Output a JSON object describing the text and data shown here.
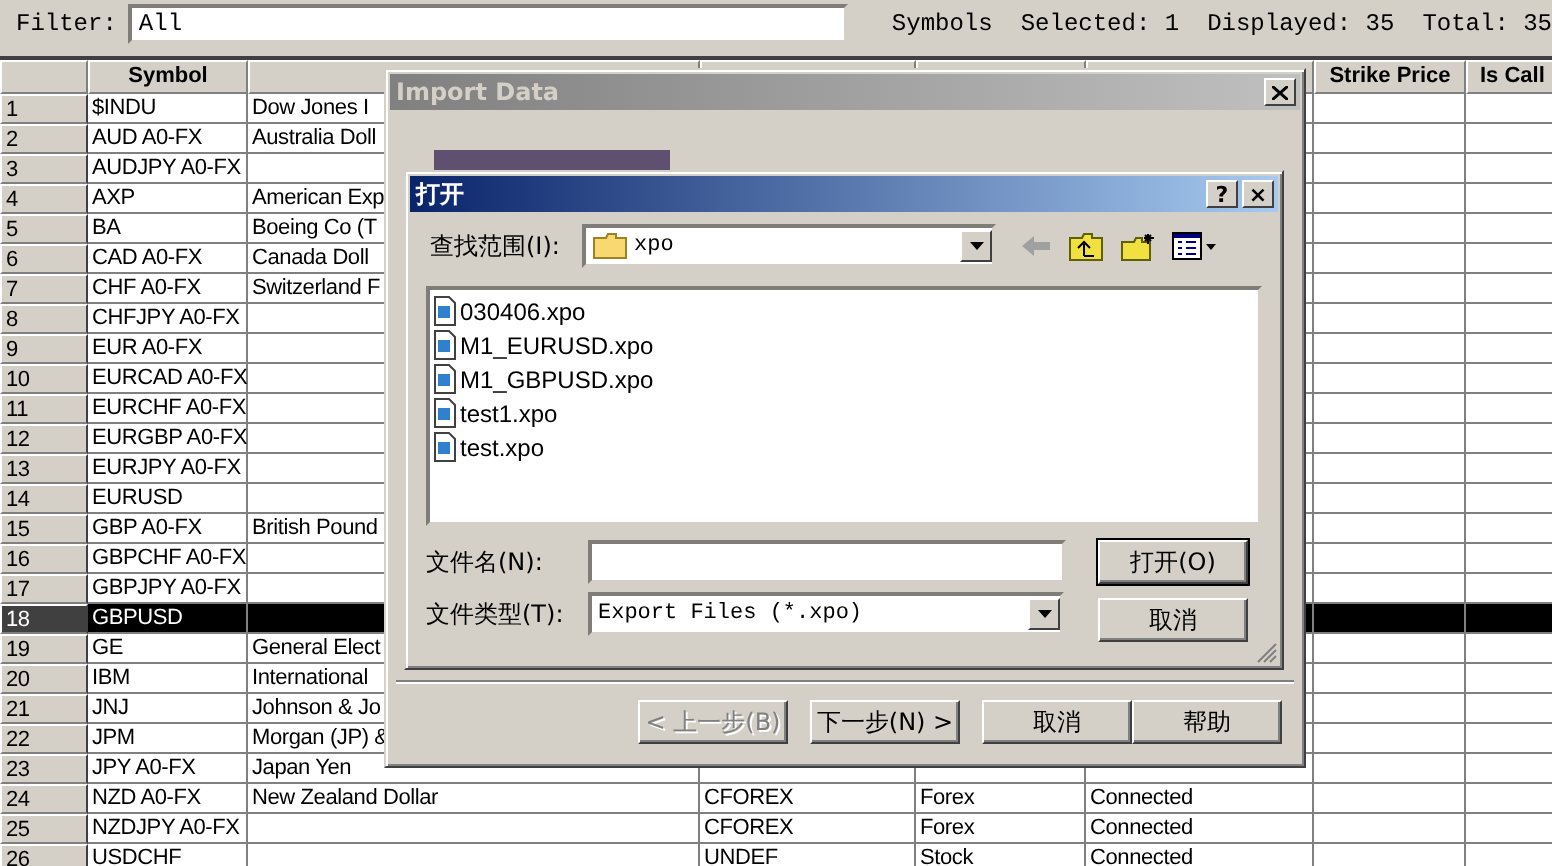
{
  "filter": {
    "label": "Filter:",
    "value": "All"
  },
  "summary": [
    "Symbols",
    "Selected: 1",
    "Displayed: 35",
    "Total: 35"
  ],
  "table": {
    "columns": [
      "Symbol",
      "Strike Price",
      "Is Call"
    ],
    "rows": [
      {
        "number": "1",
        "symbol": "$INDU",
        "description": "Dow Jones I",
        "selected": false
      },
      {
        "number": "2",
        "symbol": "AUD A0-FX",
        "description": "Australia Doll",
        "selected": false
      },
      {
        "number": "3",
        "symbol": "AUDJPY A0-FX",
        "selected": false
      },
      {
        "number": "4",
        "symbol": "AXP",
        "description": "American Exp",
        "selected": false
      },
      {
        "number": "5",
        "symbol": "BA",
        "description": "Boeing Co (T",
        "selected": false
      },
      {
        "number": "6",
        "symbol": "CAD A0-FX",
        "description": "Canada Doll",
        "selected": false
      },
      {
        "number": "7",
        "symbol": "CHF A0-FX",
        "description": "Switzerland F",
        "selected": false
      },
      {
        "number": "8",
        "symbol": "CHFJPY A0-FX",
        "selected": false
      },
      {
        "number": "9",
        "symbol": "EUR A0-FX",
        "selected": false
      },
      {
        "number": "10",
        "symbol": "EURCAD A0-FX",
        "selected": false
      },
      {
        "number": "11",
        "symbol": "EURCHF A0-FX",
        "selected": false
      },
      {
        "number": "12",
        "symbol": "EURGBP A0-FX",
        "selected": false
      },
      {
        "number": "13",
        "symbol": "EURJPY A0-FX",
        "selected": false
      },
      {
        "number": "14",
        "symbol": "EURUSD",
        "selected": false
      },
      {
        "number": "15",
        "symbol": "GBP A0-FX",
        "description": "British Pound",
        "selected": false
      },
      {
        "number": "16",
        "symbol": "GBPCHF A0-FX",
        "selected": false
      },
      {
        "number": "17",
        "symbol": "GBPJPY A0-FX",
        "selected": false
      },
      {
        "number": "18",
        "symbol": "GBPUSD",
        "selected": true
      },
      {
        "number": "19",
        "symbol": "GE",
        "description": "General Elect",
        "selected": false
      },
      {
        "number": "20",
        "symbol": "IBM",
        "description": "International",
        "selected": false
      },
      {
        "number": "21",
        "symbol": "JNJ",
        "description": "Johnson & Jo",
        "selected": false
      },
      {
        "number": "22",
        "symbol": "JPM",
        "description": "Morgan (JP) &",
        "selected": false
      },
      {
        "number": "23",
        "symbol": "JPY A0-FX",
        "description": "Japan Yen",
        "selected": false
      },
      {
        "number": "24",
        "symbol": "NZD A0-FX",
        "description": "New Zealand Dollar",
        "column_4": "CFOREX",
        "column_5": "Forex",
        "column_6": "Connected",
        "selected": false
      },
      {
        "number": "25",
        "symbol": "NZDJPY A0-FX",
        "column_4": "CFOREX",
        "column_5": "Forex",
        "column_6": "Connected",
        "selected": false
      },
      {
        "number": "26",
        "symbol": "USDCHF",
        "column_4": "UNDEF",
        "column_5": "Stock",
        "column_6": "Connected",
        "selected": false
      }
    ]
  },
  "wizard": {
    "title": "Import Data",
    "buttons": [
      {
        "label": "< 上一步(B)",
        "disabled": true
      },
      {
        "label": "下一步(N) >",
        "disabled": false
      },
      {
        "label": "取消",
        "disabled": false
      },
      {
        "label": "帮助",
        "disabled": false
      }
    ]
  },
  "open_dialog": {
    "title": "打开",
    "help_button": "?",
    "close_button": "×",
    "look_in_label": "查找范围(I):",
    "look_in_value": "xpo",
    "files": [
      "030406.xpo",
      "M1_EURUSD.xpo",
      "M1_GBPUSD.xpo",
      "test1.xpo",
      "test.xpo"
    ],
    "file_name_label": "文件名(N):",
    "file_type_label": "文件类型(T):",
    "file_type_value": "Export Files (*.xpo)",
    "buttons": [
      {
        "label": "打开(O)",
        "default": true
      },
      {
        "label": "取消",
        "default": false
      }
    ]
  }
}
